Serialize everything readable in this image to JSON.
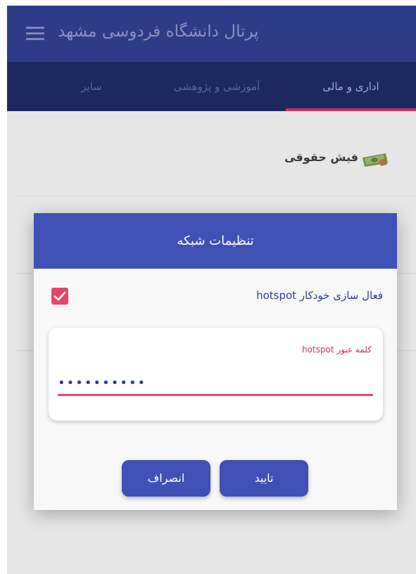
{
  "app": {
    "title": "پرتال دانشگاه فردوسی مشهد"
  },
  "tabs": [
    {
      "label": "اداری و مالی",
      "active": true
    },
    {
      "label": "آموزشی و پژوهشی",
      "active": false
    },
    {
      "label": "سایر",
      "active": false
    }
  ],
  "list": {
    "items": [
      {
        "label": "فیش حقوقی",
        "icon": "money-icon"
      }
    ]
  },
  "dialog": {
    "title": "تنظیمات شبکه",
    "checkbox_label": "فعال سازی خودکار hotspot",
    "checkbox_checked": true,
    "password_label": "کلمه عبور hotspot",
    "password_value": "••••••••••",
    "confirm_label": "تایید",
    "cancel_label": "انصراف"
  },
  "colors": {
    "app_bar": "#2d3c86",
    "tab_bar": "#1c2860",
    "dialog_accent": "#3f51b5",
    "highlight": "#e8446c"
  }
}
